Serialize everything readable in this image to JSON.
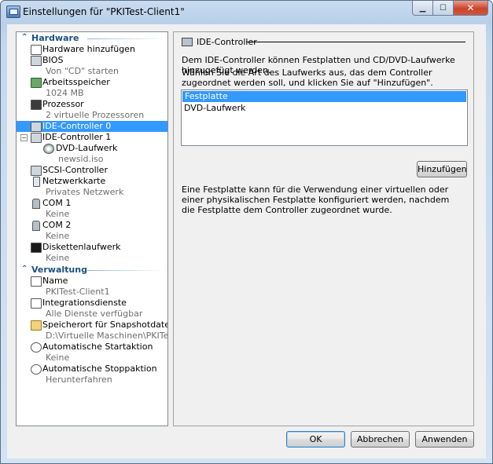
{
  "window": {
    "title": "Einstellungen für \"PKITest-Client1\""
  },
  "tree": {
    "hardware_header": "Hardware",
    "verwaltung_header": "Verwaltung",
    "hardware": [
      {
        "label": "Hardware hinzufügen"
      },
      {
        "label": "BIOS",
        "sub": "Von \"CD\" starten"
      },
      {
        "label": "Arbeitsspeicher",
        "sub": "1024 MB"
      },
      {
        "label": "Prozessor",
        "sub": "2 virtuelle Prozessoren"
      },
      {
        "label": "IDE-Controller 0"
      },
      {
        "label": "IDE-Controller 1"
      },
      {
        "label": "DVD-Laufwerk",
        "sub": "newsid.iso"
      },
      {
        "label": "SCSI-Controller"
      },
      {
        "label": "Netzwerkkarte",
        "sub": "Privates Netzwerk"
      },
      {
        "label": "COM 1",
        "sub": "Keine"
      },
      {
        "label": "COM 2",
        "sub": "Keine"
      },
      {
        "label": "Diskettenlaufwerk",
        "sub": "Keine"
      }
    ],
    "verwaltung": [
      {
        "label": "Name",
        "sub": "PKITest-Client1"
      },
      {
        "label": "Integrationsdienste",
        "sub": "Alle Dienste verfügbar"
      },
      {
        "label": "Speicherort für Snapshotdateien",
        "sub": "D:\\Virtuelle Maschinen\\PKITest-Cli..."
      },
      {
        "label": "Automatische Startaktion",
        "sub": "Keine"
      },
      {
        "label": "Automatische Stoppaktion",
        "sub": "Herunterfahren"
      }
    ]
  },
  "panel": {
    "title": "IDE-Controller",
    "desc1": "Dem IDE-Controller können Festplatten und CD/DVD-Laufwerke hinzugefügt werden.",
    "desc2": "Wählen Sie die Art des Laufwerks aus, das dem Controller zugeordnet werden soll, und klicken Sie auf \"Hinzufügen\".",
    "list": [
      "Festplatte",
      "DVD-Laufwerk"
    ],
    "add_button": "Hinzufügen",
    "desc3": "Eine Festplatte kann für die Verwendung einer virtuellen oder einer physikalischen Festplatte konfiguriert werden, nachdem die Festplatte dem Controller zugeordnet wurde."
  },
  "buttons": {
    "ok": "OK",
    "cancel": "Abbrechen",
    "apply": "Anwenden"
  }
}
